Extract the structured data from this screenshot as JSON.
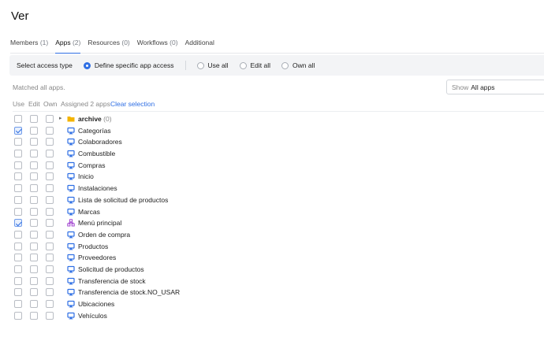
{
  "title": "Ver",
  "tabs": [
    {
      "label": "Members",
      "count": "(1)",
      "active": false
    },
    {
      "label": "Apps",
      "count": "(2)",
      "active": true
    },
    {
      "label": "Resources",
      "count": "(0)",
      "active": false
    },
    {
      "label": "Workflows",
      "count": "(0)",
      "active": false
    },
    {
      "label": "Additional",
      "count": "",
      "active": false
    }
  ],
  "access": {
    "label": "Select access type",
    "options": [
      {
        "label": "Define specific app access",
        "checked": true
      },
      {
        "label": "Use all",
        "checked": false
      },
      {
        "label": "Edit all",
        "checked": false
      },
      {
        "label": "Own all",
        "checked": false
      }
    ]
  },
  "matched": "Matched all apps.",
  "show_select": {
    "prefix": "Show",
    "value": "All apps"
  },
  "list_header": {
    "use": "Use",
    "edit": "Edit",
    "own": "Own",
    "assigned": "Assigned 2 apps",
    "clear": "Clear selection"
  },
  "colors": {
    "accent": "#2f6fe4",
    "folder": "#f4b400",
    "app_icon": "#2f6fe4",
    "module_icon": "#a347d1"
  },
  "apps": [
    {
      "name": "archive",
      "count": "(0)",
      "type": "folder",
      "use": false
    },
    {
      "name": "Categorías",
      "type": "app-icon",
      "use": true
    },
    {
      "name": "Colaboradores",
      "type": "app-icon",
      "use": false
    },
    {
      "name": "Combustible",
      "type": "app-icon",
      "use": false
    },
    {
      "name": "Compras",
      "type": "app-icon",
      "use": false
    },
    {
      "name": "Inicio",
      "type": "app-icon",
      "use": false
    },
    {
      "name": "Instalaciones",
      "type": "app-icon",
      "use": false
    },
    {
      "name": "Lista de solicitud de productos",
      "type": "app-icon",
      "use": false
    },
    {
      "name": "Marcas",
      "type": "app-icon",
      "use": false
    },
    {
      "name": "Menú principal",
      "type": "module-icon",
      "use": true
    },
    {
      "name": "Orden de compra",
      "type": "app-icon",
      "use": false
    },
    {
      "name": "Productos",
      "type": "app-icon",
      "use": false
    },
    {
      "name": "Proveedores",
      "type": "app-icon",
      "use": false
    },
    {
      "name": "Solicitud de productos",
      "type": "app-icon",
      "use": false
    },
    {
      "name": "Transferencia de stock",
      "type": "app-icon",
      "use": false
    },
    {
      "name": "Transferencia de stock.NO_USAR",
      "type": "app-icon",
      "use": false
    },
    {
      "name": "Ubicaciones",
      "type": "app-icon",
      "use": false
    },
    {
      "name": "Vehículos",
      "type": "app-icon",
      "use": false
    }
  ]
}
